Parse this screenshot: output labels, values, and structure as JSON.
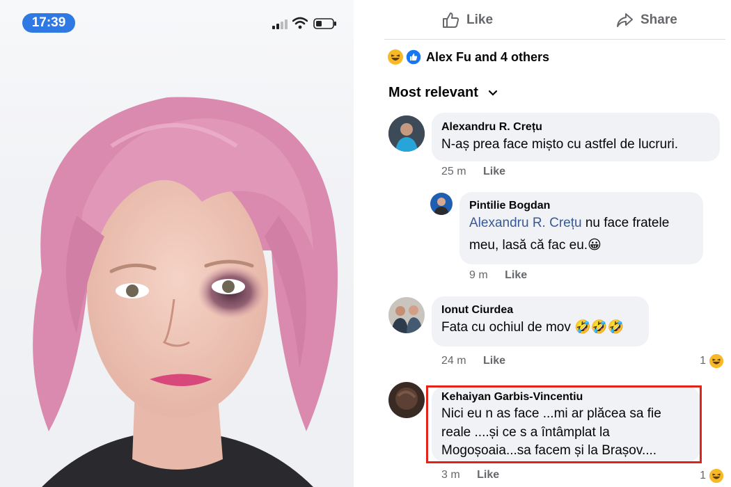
{
  "status_bar": {
    "time": "17:39"
  },
  "actions": {
    "like_label": "Like",
    "share_label": "Share"
  },
  "reactions": {
    "names": "Alex Fu and 4 others",
    "icons": [
      "laugh-reaction",
      "like-reaction"
    ]
  },
  "sort": {
    "label": "Most relevant"
  },
  "comments": [
    {
      "author": "Alexandru R. Crețu",
      "text": "N-aș prea face mișto cu astfel de lucruri.",
      "time": "25 m",
      "like": "Like"
    },
    {
      "author": "Pintilie Bogdan",
      "mention": "Alexandru R. Crețu",
      "text_line1": " nu face fratele",
      "text_line2": "meu, lasă că fac eu.",
      "emoji": "😀",
      "time": "9 m",
      "like": "Like"
    },
    {
      "author": "Ionut Ciurdea",
      "text": "Fata cu ochiul de mov",
      "emoji": "🤣🤣🤣",
      "time": "24 m",
      "like": "Like",
      "reaction_count": "1"
    },
    {
      "author": "Kehaiyan Garbis-Vincentiu",
      "text_line1": "Nici eu n as face ...mi ar plăcea sa fie",
      "text_line2": "reale ....și ce s a întâmplat la",
      "text_line3": "Mogoșoaia...sa facem și la Brașov....",
      "time": "3 m",
      "like": "Like",
      "reaction_count": "1"
    }
  ],
  "colors": {
    "accent": "#2f79e5",
    "highlight": "#e2231a",
    "link": "#385898"
  }
}
